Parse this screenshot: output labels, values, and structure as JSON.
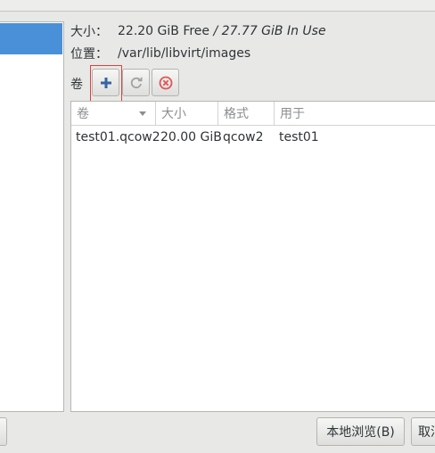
{
  "pool_info": {
    "size_label": "大小：",
    "size_free": "22.20 GiB Free",
    "size_sep": " / ",
    "size_in_use": "27.77 GiB In Use",
    "location_label": "位置：",
    "location_value": "/var/lib/libvirt/images"
  },
  "toolbar": {
    "volumes_label": "卷",
    "add_icon": "plus-icon",
    "refresh_icon": "refresh-icon",
    "delete_icon": "delete-icon",
    "colors": {
      "add": "#3465a4",
      "refresh": "#a0a2a0",
      "delete": "#e05555"
    }
  },
  "volumes_table": {
    "columns": [
      "卷",
      "大小",
      "格式",
      "用于"
    ],
    "rows": [
      [
        "test01.qcow2",
        "20.00 GiB",
        "qcow2",
        "test01"
      ]
    ]
  },
  "buttons": {
    "browse_local": "本地浏览(B)",
    "cancel": "取消"
  },
  "colors": {
    "selection": "#4a90d9",
    "focus": "#e0403a"
  }
}
